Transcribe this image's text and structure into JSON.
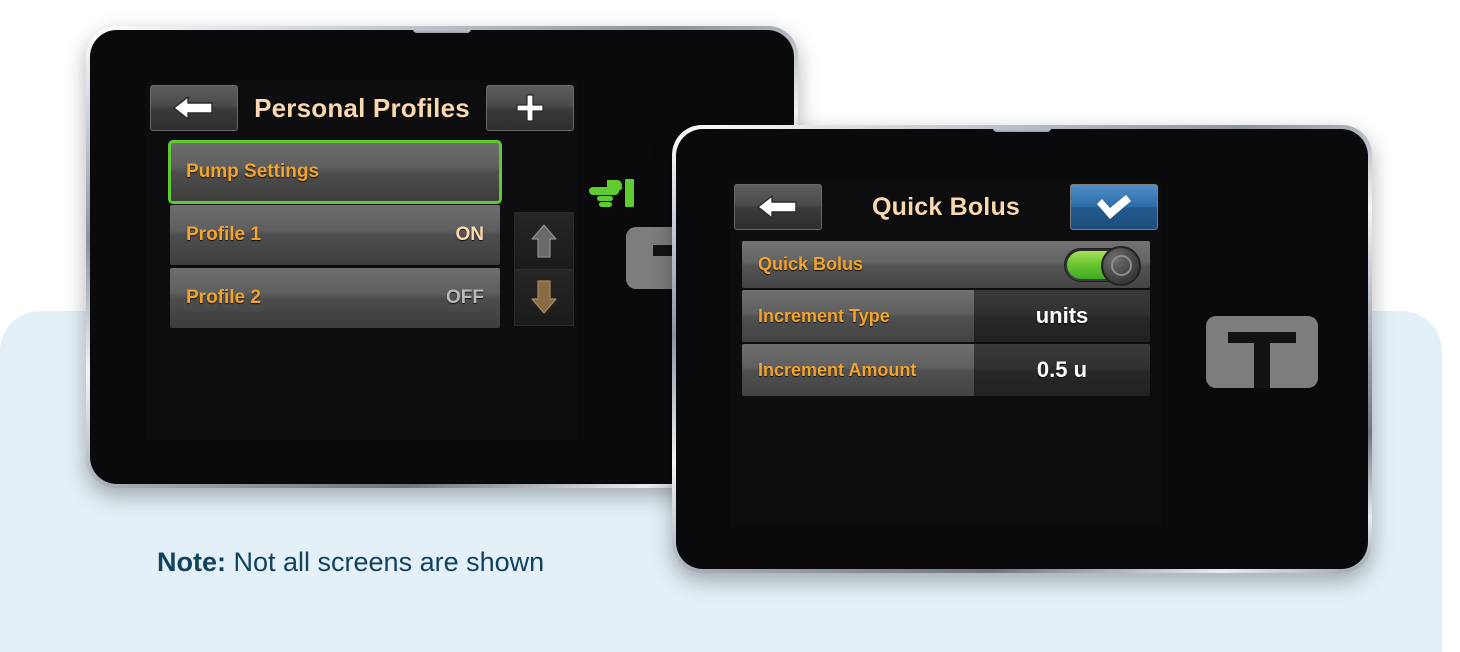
{
  "background": {
    "page_color": "#ffffff",
    "panel_color": "#e4f0f8"
  },
  "note": {
    "prefix": "Note:",
    "text": " Not all screens are shown",
    "color": "#10425e"
  },
  "colors": {
    "label_orange": "#f4a42a",
    "title_cream": "#fbd9ae",
    "value_white": "#ffffff",
    "value_off_gray": "#b9b9b9",
    "selection_green": "#5ecb32",
    "accept_blue": "#2e6ea8",
    "toggle_green": "#6ec832",
    "hand_green": "#5ecb32",
    "hw_button_gray": "#7d7d7d"
  },
  "pointer": {
    "icon": "pointing-hand-right-icon",
    "color": "#5ecb32"
  },
  "left_device": {
    "hardware_button": {
      "icon": "tandem-logo-button-icon",
      "label": "screen-on-button"
    },
    "screen": {
      "header": {
        "back_button": {
          "icon": "arrow-left-icon",
          "label": "Back"
        },
        "title": "Personal Profiles",
        "add_button": {
          "icon": "plus-icon",
          "label": "Add"
        }
      },
      "list": [
        {
          "label": "Pump Settings",
          "value": "",
          "selected": true
        },
        {
          "label": "Profile 1",
          "value": "ON",
          "state": "on",
          "selected": false
        },
        {
          "label": "Profile 2",
          "value": "OFF",
          "state": "off",
          "selected": false
        }
      ],
      "scroll": {
        "up": {
          "icon": "arrow-up-icon",
          "state": "inactive"
        },
        "down": {
          "icon": "arrow-down-icon",
          "state": "active"
        }
      }
    }
  },
  "right_device": {
    "hardware_button": {
      "icon": "tandem-t-logo-icon",
      "label": "screen-on-button"
    },
    "screen": {
      "header": {
        "back_button": {
          "icon": "arrow-left-icon",
          "label": "Back"
        },
        "title": "Quick Bolus",
        "accept_button": {
          "icon": "checkmark-icon",
          "label": "Accept"
        }
      },
      "toggle_row": {
        "label": "Quick Bolus",
        "toggle_state": "on"
      },
      "settings": [
        {
          "label": "Increment Type",
          "value": "units"
        },
        {
          "label": "Increment Amount",
          "value": "0.5 u"
        }
      ]
    }
  }
}
